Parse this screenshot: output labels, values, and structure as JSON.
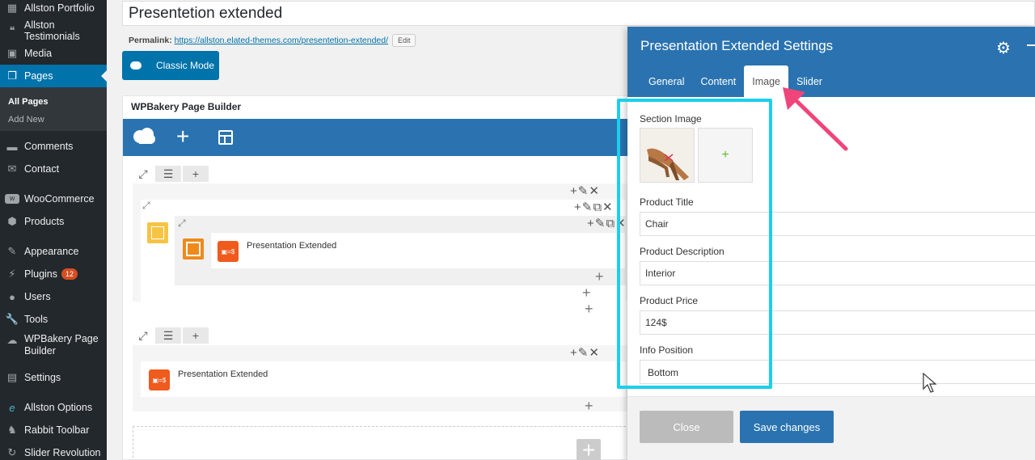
{
  "sidebar": {
    "items": [
      {
        "label": "Allston Portfolio",
        "icon": "grid-icon"
      },
      {
        "label": "Allston Testimonials",
        "icon": "quote-icon"
      },
      {
        "label": "Media",
        "icon": "media-icon"
      },
      {
        "label": "Pages",
        "icon": "pages-icon"
      },
      {
        "label": "Comments",
        "icon": "comment-icon"
      },
      {
        "label": "Contact",
        "icon": "mail-icon"
      },
      {
        "label": "WooCommerce",
        "icon": "woo-icon"
      },
      {
        "label": "Products",
        "icon": "box-icon"
      },
      {
        "label": "Appearance",
        "icon": "brush-icon"
      },
      {
        "label": "Plugins",
        "icon": "plug-icon",
        "badge": "12"
      },
      {
        "label": "Users",
        "icon": "user-icon"
      },
      {
        "label": "Tools",
        "icon": "wrench-icon"
      },
      {
        "label": "WPBakery Page",
        "label2": "Builder",
        "icon": "cloud-icon"
      },
      {
        "label": "Settings",
        "icon": "settings-icon"
      },
      {
        "label": "Allston Options",
        "icon": "e-icon"
      },
      {
        "label": "Rabbit Toolbar",
        "icon": "rabbit-icon"
      },
      {
        "label": "Slider Revolution",
        "icon": "refresh-icon"
      }
    ],
    "submenu": [
      "All Pages",
      "Add New"
    ]
  },
  "editor": {
    "title": "Presentetion extended",
    "permalink_label": "Permalink:",
    "permalink_url": "https://allston.elated-themes.com/presentetion-extended/",
    "edit_label": "Edit",
    "classic_mode": "Classic Mode",
    "wpb_title": "WPBakery Page Builder",
    "element_label_1": "Presentation Extended",
    "element_label_2": "Presentation Extended"
  },
  "modal": {
    "title": "Presentation Extended Settings",
    "tabs": [
      "General",
      "Content",
      "Image",
      "Slider"
    ],
    "active_tab": "Image",
    "fields": {
      "section_image_label": "Section Image",
      "product_title_label": "Product Title",
      "product_title_value": "Chair",
      "product_description_label": "Product Description",
      "product_description_value": "Interior",
      "product_price_label": "Product Price",
      "product_price_value": "124$",
      "info_position_label": "Info Position",
      "info_position_value": "Bottom"
    },
    "close_label": "Close",
    "save_label": "Save changes"
  },
  "colors": {
    "wp_sidebar": "#23282d",
    "wp_blue": "#0073aa",
    "wpb_blue": "#2a73b0",
    "highlight": "#1ad0ec",
    "arrow": "#f0457a"
  }
}
